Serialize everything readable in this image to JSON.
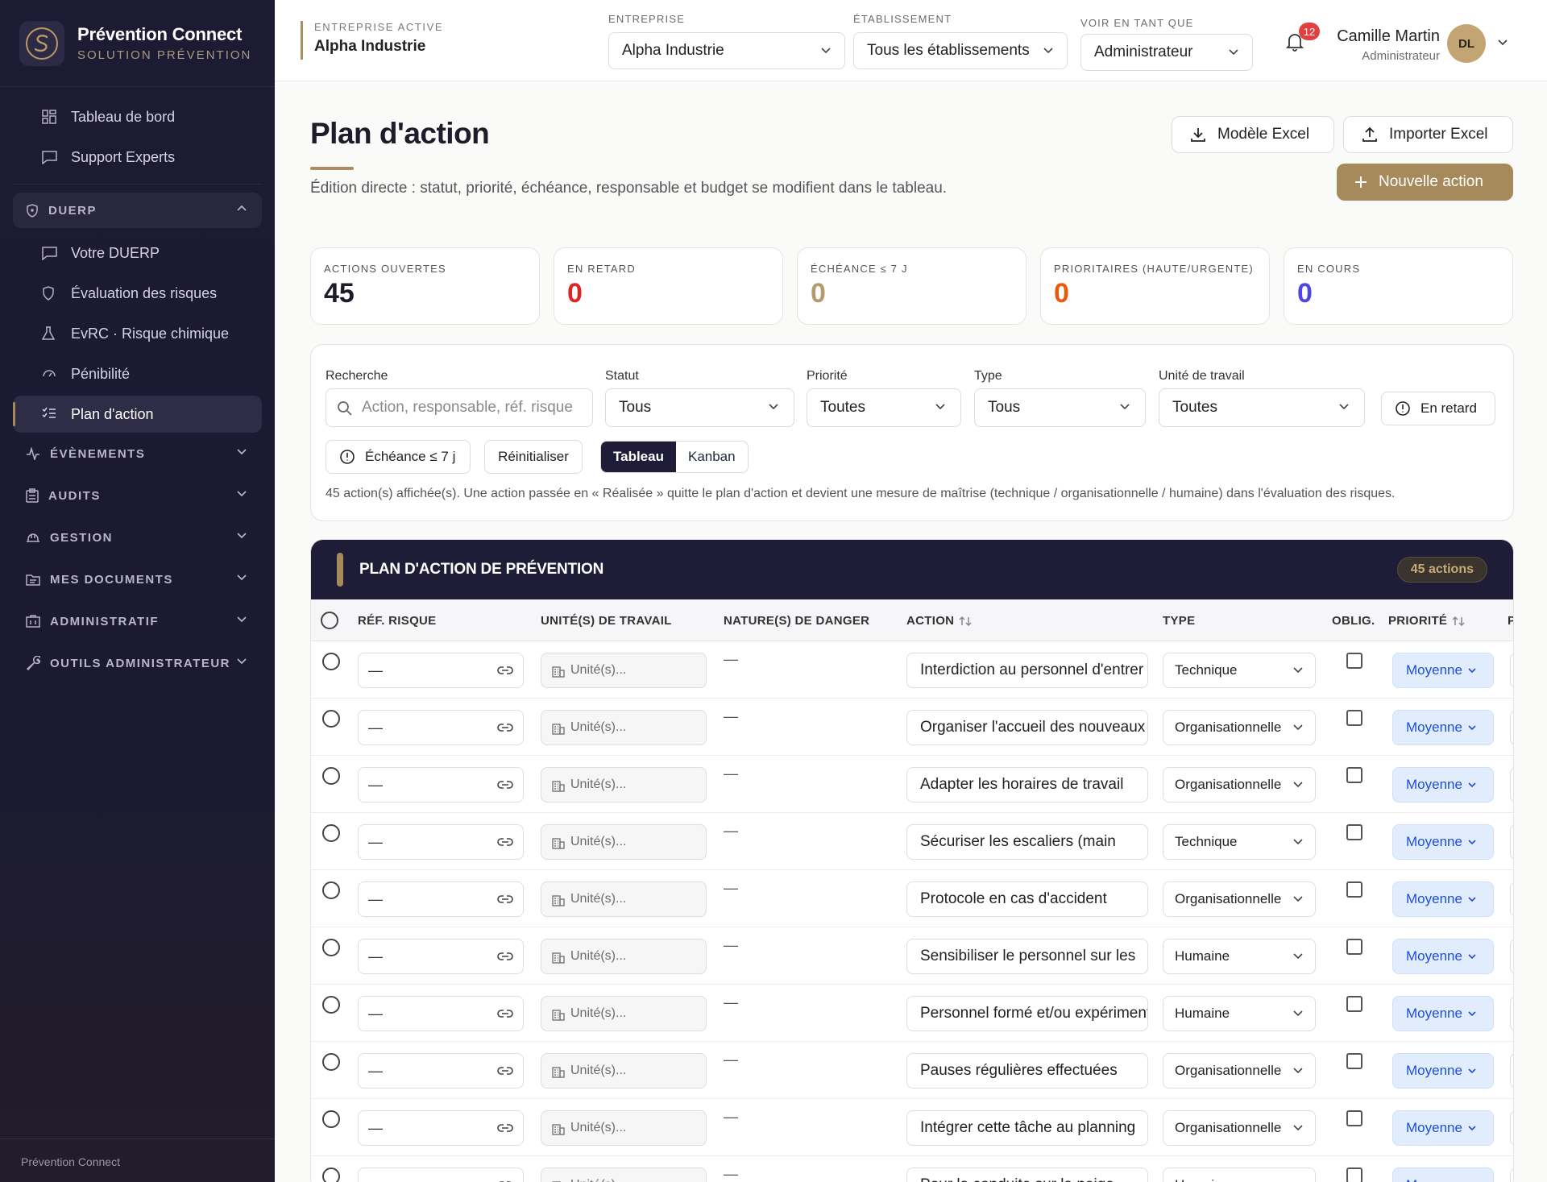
{
  "brand": {
    "name": "Prévention Connect",
    "subtitle": "SOLUTION PRÉVENTION"
  },
  "sidebar": {
    "top_items": [
      {
        "label": "Tableau de bord",
        "icon": "dashboard-icon"
      },
      {
        "label": "Support Experts",
        "icon": "chat-icon"
      }
    ],
    "duerp": {
      "label": "DUERP",
      "items": [
        {
          "label": "Votre DUERP",
          "icon": "chat-icon"
        },
        {
          "label": "Évaluation des risques",
          "icon": "shield-icon"
        },
        {
          "label": "EvRC · Risque chimique",
          "icon": "flask-icon"
        },
        {
          "label": "Pénibilité",
          "icon": "gauge-icon"
        },
        {
          "label": "Plan d'action",
          "icon": "checklist-icon",
          "active": true
        }
      ]
    },
    "groups": [
      {
        "label": "ÉVÈNEMENTS",
        "icon": "pulse-icon"
      },
      {
        "label": "AUDITS",
        "icon": "clipboard-icon"
      },
      {
        "label": "GESTION",
        "icon": "helmet-icon"
      },
      {
        "label": "MES DOCUMENTS",
        "icon": "folder-icon"
      },
      {
        "label": "ADMINISTRATIF",
        "icon": "building-icon"
      },
      {
        "label": "OUTILS ADMINISTRATEUR",
        "icon": "wrench-icon"
      }
    ],
    "footer": "Prévention Connect"
  },
  "topbar": {
    "active_company_label": "ENTREPRISE ACTIVE",
    "active_company": "Alpha Industrie",
    "company_label": "ENTREPRISE",
    "company_value": "Alpha Industrie",
    "site_label": "ÉTABLISSEMENT",
    "site_value": "Tous les établissements",
    "role_label": "VOIR EN TANT QUE",
    "role_value": "Administrateur",
    "notifications": "12",
    "user_name": "Camille Martin",
    "user_role": "Administrateur",
    "user_initials": "DL"
  },
  "page": {
    "title": "Plan d'action",
    "subtitle": "Édition directe : statut, priorité, échéance, responsable et budget se modifient dans le tableau.",
    "btn_template": "Modèle Excel",
    "btn_import": "Importer Excel",
    "btn_new": "Nouvelle action"
  },
  "kpis": [
    {
      "label": "ACTIONS OUVERTES",
      "value": "45",
      "color": "#1c1c2a"
    },
    {
      "label": "EN RETARD",
      "value": "0",
      "color": "#dc2626"
    },
    {
      "label": "ÉCHÉANCE ≤ 7 J",
      "value": "0",
      "color": "#b59a6d"
    },
    {
      "label": "PRIORITAIRES (HAUTE/URGENTE)",
      "value": "0",
      "color": "#ea580c"
    },
    {
      "label": "EN COURS",
      "value": "0",
      "color": "#4f46e5"
    }
  ],
  "filters": {
    "search_label": "Recherche",
    "search_placeholder": "Action, responsable, réf. risque",
    "status_label": "Statut",
    "status_value": "Tous",
    "priority_label": "Priorité",
    "priority_value": "Toutes",
    "type_label": "Type",
    "type_value": "Tous",
    "unit_label": "Unité de travail",
    "unit_value": "Toutes",
    "late_chip": "En retard",
    "due_chip": "Échéance ≤ 7 j",
    "reset": "Réinitialiser",
    "view_table": "Tableau",
    "view_kanban": "Kanban",
    "info": "45 action(s) affichée(s). Une action passée en « Réalisée » quitte le plan d'action et devient une mesure de maîtrise (technique / organisationnelle / humaine) dans l'évaluation des risques."
  },
  "table": {
    "title": "PLAN D'ACTION DE PRÉVENTION",
    "count": "45 actions",
    "columns": {
      "ref": "RÉF. RISQUE",
      "units": "UNITÉ(S) DE TRAVAIL",
      "danger": "NATURE(S) DE DANGER",
      "action": "ACTION",
      "type": "TYPE",
      "oblig": "OBLIG.",
      "priority": "PRIORITÉ",
      "next": "P"
    },
    "unit_placeholder": "Unité(s)...",
    "rows": [
      {
        "ref": "—",
        "danger": "—",
        "action": "Interdiction au personnel d'entrer",
        "type": "Technique",
        "priority": "Moyenne"
      },
      {
        "ref": "—",
        "danger": "—",
        "action": "Organiser l'accueil des nouveaux",
        "type": "Organisationnelle",
        "priority": "Moyenne"
      },
      {
        "ref": "—",
        "danger": "—",
        "action": "Adapter les horaires de travail",
        "type": "Organisationnelle",
        "priority": "Moyenne"
      },
      {
        "ref": "—",
        "danger": "—",
        "action": "Sécuriser les escaliers (main",
        "type": "Technique",
        "priority": "Moyenne"
      },
      {
        "ref": "—",
        "danger": "—",
        "action": "Protocole en cas d'accident",
        "type": "Organisationnelle",
        "priority": "Moyenne"
      },
      {
        "ref": "—",
        "danger": "—",
        "action": "Sensibiliser le personnel sur les",
        "type": "Humaine",
        "priority": "Moyenne"
      },
      {
        "ref": "—",
        "danger": "—",
        "action": "Personnel formé et/ou expérimenté",
        "type": "Humaine",
        "priority": "Moyenne"
      },
      {
        "ref": "—",
        "danger": "—",
        "action": "Pauses régulières effectuées",
        "type": "Organisationnelle",
        "priority": "Moyenne"
      },
      {
        "ref": "—",
        "danger": "—",
        "action": "Intégrer cette tâche au planning",
        "type": "Organisationnelle",
        "priority": "Moyenne"
      },
      {
        "ref": "—",
        "danger": "—",
        "action": "Pour la conduite sur la neige",
        "type": "Humaine",
        "priority": "Moyenne"
      }
    ]
  },
  "colors": {
    "sidebar": "#1d1b33",
    "accent": "#a68a5b",
    "dark_header": "#1e1c36",
    "priority_bg": "#e1edfd"
  }
}
